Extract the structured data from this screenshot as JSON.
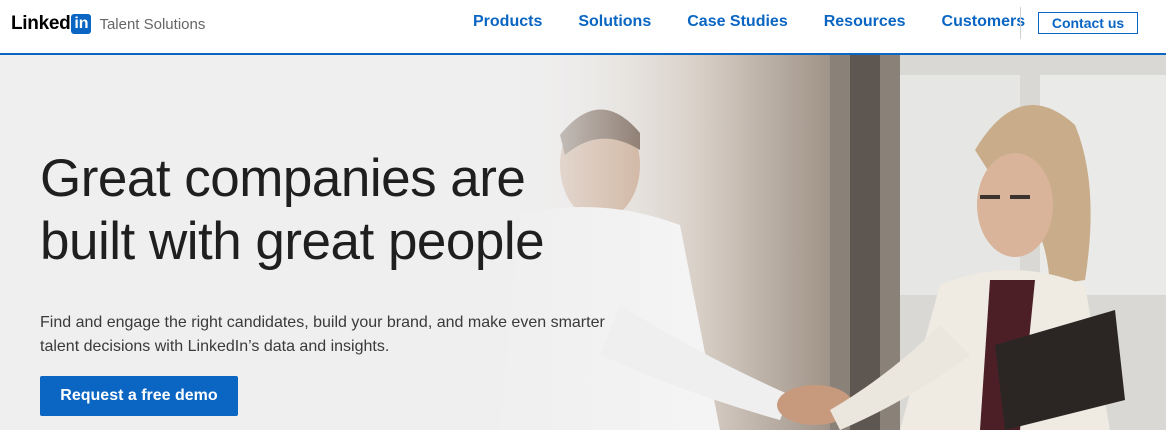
{
  "header": {
    "logo_word": "Linked",
    "logo_box": "in",
    "logo_sub": "Talent Solutions",
    "nav": [
      "Products",
      "Solutions",
      "Case Studies",
      "Resources",
      "Customers"
    ],
    "contact_label": "Contact us"
  },
  "hero": {
    "title_line1": "Great companies are",
    "title_line2": "built with great people",
    "description_line1": "Find and engage the right candidates, build your brand, and make even smarter",
    "description_line2": "talent decisions with LinkedIn’s data and insights.",
    "cta_label": "Request a free demo"
  },
  "colors": {
    "brand_blue": "#0a66c2",
    "hero_bg": "#efefef"
  }
}
